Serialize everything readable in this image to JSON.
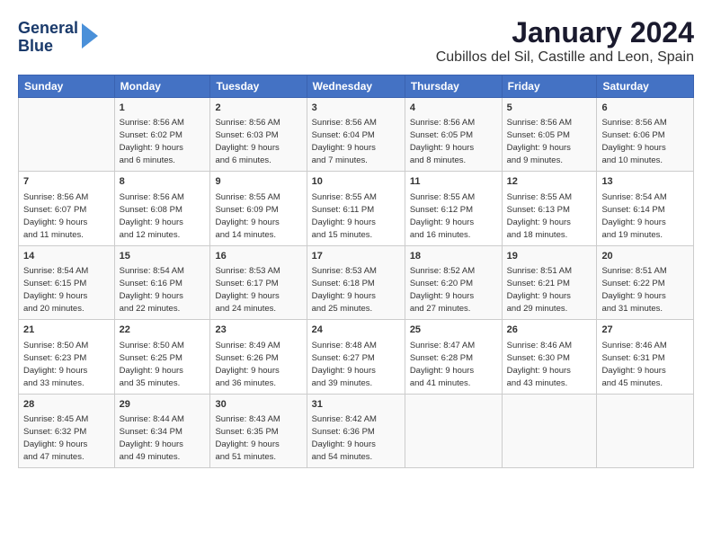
{
  "logo": {
    "line1": "General",
    "line2": "Blue"
  },
  "title": "January 2024",
  "subtitle": "Cubillos del Sil, Castille and Leon, Spain",
  "days_of_week": [
    "Sunday",
    "Monday",
    "Tuesday",
    "Wednesday",
    "Thursday",
    "Friday",
    "Saturday"
  ],
  "weeks": [
    [
      {
        "day": "",
        "info": ""
      },
      {
        "day": "1",
        "info": "Sunrise: 8:56 AM\nSunset: 6:02 PM\nDaylight: 9 hours\nand 6 minutes."
      },
      {
        "day": "2",
        "info": "Sunrise: 8:56 AM\nSunset: 6:03 PM\nDaylight: 9 hours\nand 6 minutes."
      },
      {
        "day": "3",
        "info": "Sunrise: 8:56 AM\nSunset: 6:04 PM\nDaylight: 9 hours\nand 7 minutes."
      },
      {
        "day": "4",
        "info": "Sunrise: 8:56 AM\nSunset: 6:05 PM\nDaylight: 9 hours\nand 8 minutes."
      },
      {
        "day": "5",
        "info": "Sunrise: 8:56 AM\nSunset: 6:05 PM\nDaylight: 9 hours\nand 9 minutes."
      },
      {
        "day": "6",
        "info": "Sunrise: 8:56 AM\nSunset: 6:06 PM\nDaylight: 9 hours\nand 10 minutes."
      }
    ],
    [
      {
        "day": "7",
        "info": "Sunrise: 8:56 AM\nSunset: 6:07 PM\nDaylight: 9 hours\nand 11 minutes."
      },
      {
        "day": "8",
        "info": "Sunrise: 8:56 AM\nSunset: 6:08 PM\nDaylight: 9 hours\nand 12 minutes."
      },
      {
        "day": "9",
        "info": "Sunrise: 8:55 AM\nSunset: 6:09 PM\nDaylight: 9 hours\nand 14 minutes."
      },
      {
        "day": "10",
        "info": "Sunrise: 8:55 AM\nSunset: 6:11 PM\nDaylight: 9 hours\nand 15 minutes."
      },
      {
        "day": "11",
        "info": "Sunrise: 8:55 AM\nSunset: 6:12 PM\nDaylight: 9 hours\nand 16 minutes."
      },
      {
        "day": "12",
        "info": "Sunrise: 8:55 AM\nSunset: 6:13 PM\nDaylight: 9 hours\nand 18 minutes."
      },
      {
        "day": "13",
        "info": "Sunrise: 8:54 AM\nSunset: 6:14 PM\nDaylight: 9 hours\nand 19 minutes."
      }
    ],
    [
      {
        "day": "14",
        "info": "Sunrise: 8:54 AM\nSunset: 6:15 PM\nDaylight: 9 hours\nand 20 minutes."
      },
      {
        "day": "15",
        "info": "Sunrise: 8:54 AM\nSunset: 6:16 PM\nDaylight: 9 hours\nand 22 minutes."
      },
      {
        "day": "16",
        "info": "Sunrise: 8:53 AM\nSunset: 6:17 PM\nDaylight: 9 hours\nand 24 minutes."
      },
      {
        "day": "17",
        "info": "Sunrise: 8:53 AM\nSunset: 6:18 PM\nDaylight: 9 hours\nand 25 minutes."
      },
      {
        "day": "18",
        "info": "Sunrise: 8:52 AM\nSunset: 6:20 PM\nDaylight: 9 hours\nand 27 minutes."
      },
      {
        "day": "19",
        "info": "Sunrise: 8:51 AM\nSunset: 6:21 PM\nDaylight: 9 hours\nand 29 minutes."
      },
      {
        "day": "20",
        "info": "Sunrise: 8:51 AM\nSunset: 6:22 PM\nDaylight: 9 hours\nand 31 minutes."
      }
    ],
    [
      {
        "day": "21",
        "info": "Sunrise: 8:50 AM\nSunset: 6:23 PM\nDaylight: 9 hours\nand 33 minutes."
      },
      {
        "day": "22",
        "info": "Sunrise: 8:50 AM\nSunset: 6:25 PM\nDaylight: 9 hours\nand 35 minutes."
      },
      {
        "day": "23",
        "info": "Sunrise: 8:49 AM\nSunset: 6:26 PM\nDaylight: 9 hours\nand 36 minutes."
      },
      {
        "day": "24",
        "info": "Sunrise: 8:48 AM\nSunset: 6:27 PM\nDaylight: 9 hours\nand 39 minutes."
      },
      {
        "day": "25",
        "info": "Sunrise: 8:47 AM\nSunset: 6:28 PM\nDaylight: 9 hours\nand 41 minutes."
      },
      {
        "day": "26",
        "info": "Sunrise: 8:46 AM\nSunset: 6:30 PM\nDaylight: 9 hours\nand 43 minutes."
      },
      {
        "day": "27",
        "info": "Sunrise: 8:46 AM\nSunset: 6:31 PM\nDaylight: 9 hours\nand 45 minutes."
      }
    ],
    [
      {
        "day": "28",
        "info": "Sunrise: 8:45 AM\nSunset: 6:32 PM\nDaylight: 9 hours\nand 47 minutes."
      },
      {
        "day": "29",
        "info": "Sunrise: 8:44 AM\nSunset: 6:34 PM\nDaylight: 9 hours\nand 49 minutes."
      },
      {
        "day": "30",
        "info": "Sunrise: 8:43 AM\nSunset: 6:35 PM\nDaylight: 9 hours\nand 51 minutes."
      },
      {
        "day": "31",
        "info": "Sunrise: 8:42 AM\nSunset: 6:36 PM\nDaylight: 9 hours\nand 54 minutes."
      },
      {
        "day": "",
        "info": ""
      },
      {
        "day": "",
        "info": ""
      },
      {
        "day": "",
        "info": ""
      }
    ]
  ]
}
